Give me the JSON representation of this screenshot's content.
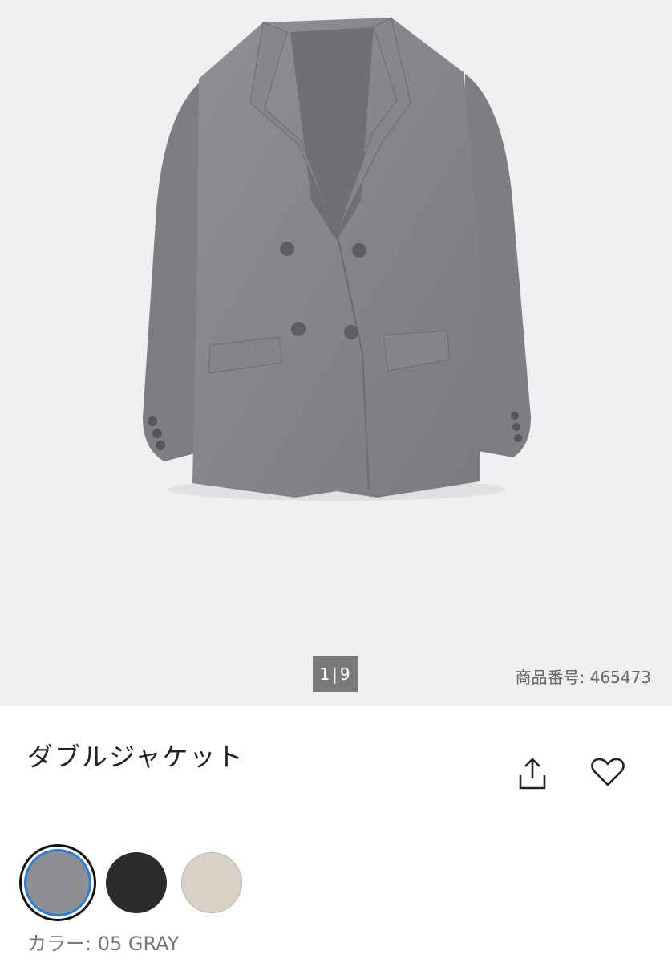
{
  "gallery": {
    "image_alt": "gray double-breasted jacket",
    "pager": {
      "current": "1",
      "separator": "|",
      "total": "9"
    },
    "product_number": "商品番号: 465473"
  },
  "product": {
    "title": "ダブルジャケット"
  },
  "actions": {
    "share_icon": "share-icon",
    "favorite_icon": "heart-icon"
  },
  "colors": {
    "swatches": [
      {
        "name": "gray",
        "hex": "#8e8f92",
        "selected": true
      },
      {
        "name": "black",
        "hex": "#2b2b2b",
        "selected": false
      },
      {
        "name": "beige",
        "hex": "#d9d0c6",
        "selected": false
      }
    ],
    "label": "カラー: 05 GRAY"
  }
}
